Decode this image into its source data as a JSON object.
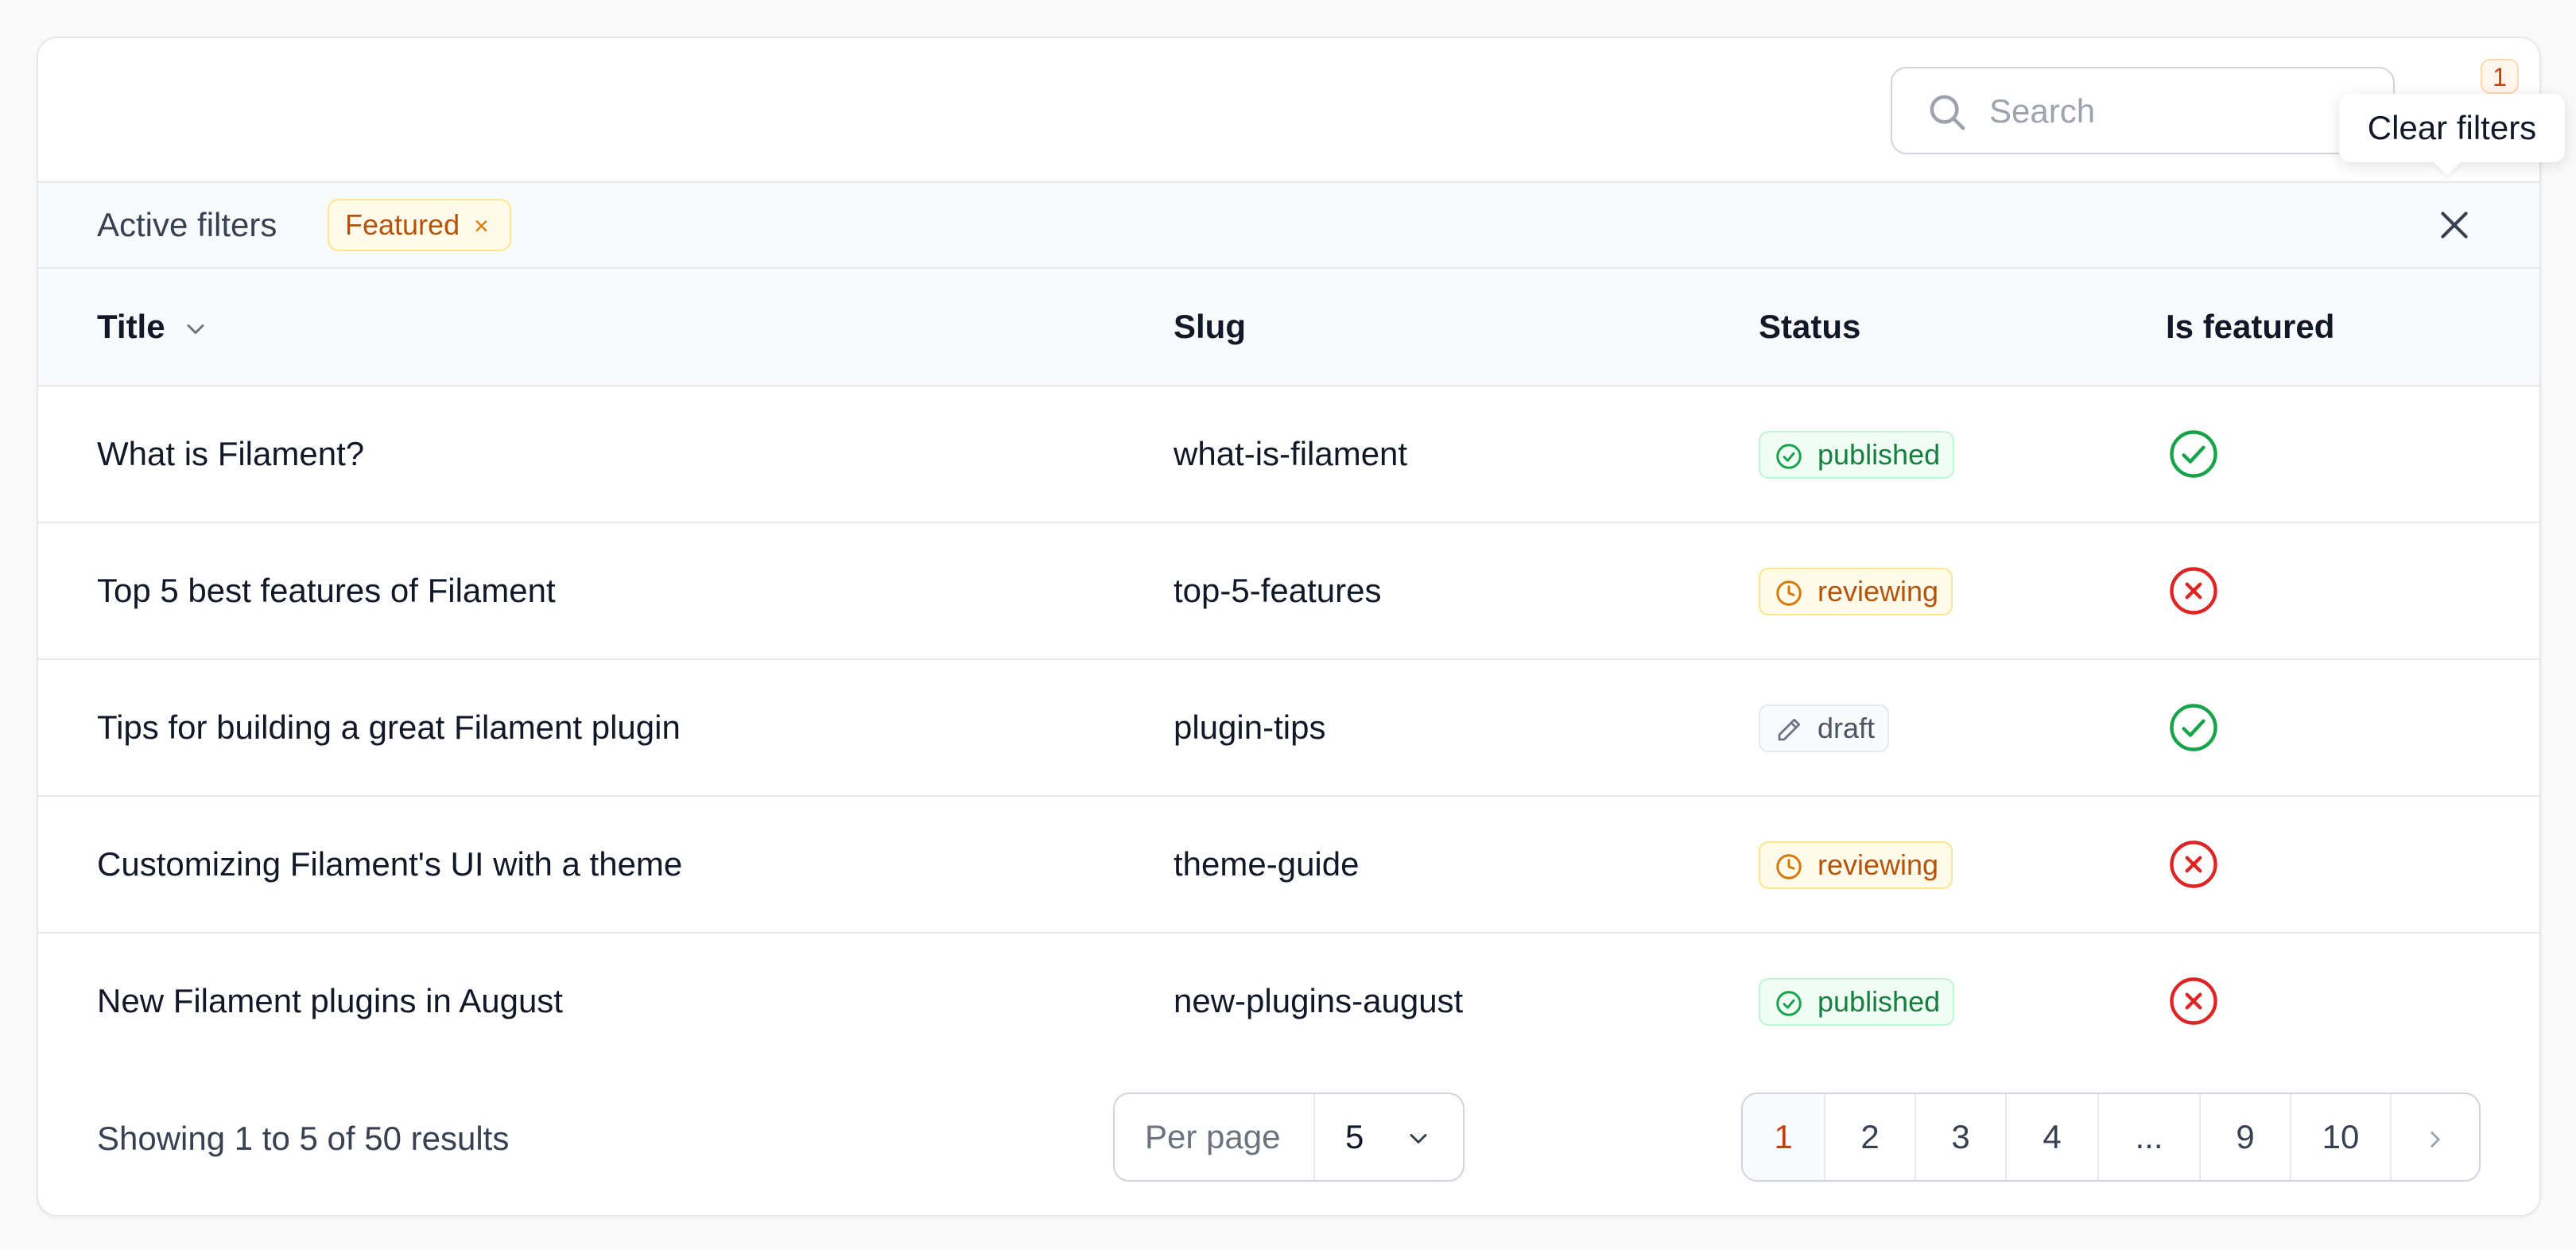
{
  "search": {
    "placeholder": "Search"
  },
  "filter_badge": "1",
  "tooltip": "Clear filters",
  "active_filters": {
    "label": "Active filters",
    "chips": [
      {
        "label": "Featured",
        "remove": "×"
      }
    ]
  },
  "columns": {
    "title": "Title",
    "slug": "Slug",
    "status": "Status",
    "featured": "Is featured"
  },
  "rows": [
    {
      "title": "What is Filament?",
      "slug": "what-is-filament",
      "status": "published",
      "featured": true
    },
    {
      "title": "Top 5 best features of Filament",
      "slug": "top-5-features",
      "status": "reviewing",
      "featured": false
    },
    {
      "title": "Tips for building a great Filament plugin",
      "slug": "plugin-tips",
      "status": "draft",
      "featured": true
    },
    {
      "title": "Customizing Filament's UI with a theme",
      "slug": "theme-guide",
      "status": "reviewing",
      "featured": false
    },
    {
      "title": "New Filament plugins in August",
      "slug": "new-plugins-august",
      "status": "published",
      "featured": false
    }
  ],
  "footer": {
    "showing": "Showing 1 to 5 of 50 results",
    "per_page_label": "Per page",
    "per_page_value": "5",
    "pages": [
      "1",
      "2",
      "3",
      "4",
      "...",
      "9",
      "10"
    ],
    "active_page": "1"
  },
  "colors": {
    "accent": "#c2410c",
    "success": "#16a34a",
    "danger": "#dc2626"
  }
}
